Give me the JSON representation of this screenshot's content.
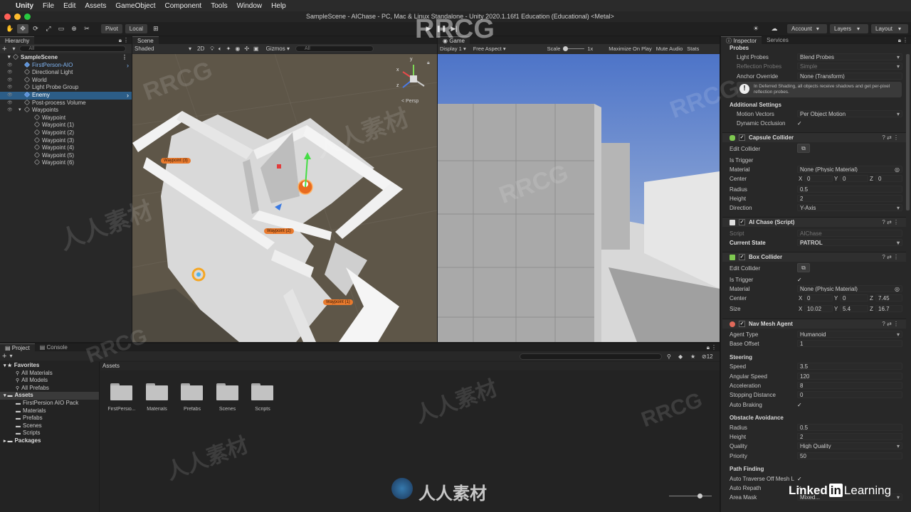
{
  "menubar": {
    "apple": "",
    "app": "Unity",
    "items": [
      "File",
      "Edit",
      "Assets",
      "GameObject",
      "Component",
      "Tools",
      "Window",
      "Help"
    ]
  },
  "window": {
    "title": "SampleScene - AIChase - PC, Mac & Linux Standalone - Unity 2020.1.16f1 Education (Educational) <Metal>"
  },
  "toolbar": {
    "pivot": "Pivot",
    "local": "Local",
    "account": "Account",
    "layers": "Layers",
    "layout": "Layout"
  },
  "hierarchy": {
    "tab": "Hierarchy",
    "search": "All",
    "scene": "SampleScene",
    "items": [
      {
        "label": "FirstPerson-AIO",
        "depth": 1,
        "prefab": true
      },
      {
        "label": "Directional Light",
        "depth": 1
      },
      {
        "label": "World",
        "depth": 1
      },
      {
        "label": "Light Probe Group",
        "depth": 1
      },
      {
        "label": "Enemy",
        "depth": 1,
        "selected": true
      },
      {
        "label": "Post-process Volume",
        "depth": 1
      },
      {
        "label": "Waypoints",
        "depth": 1
      },
      {
        "label": "Waypoint",
        "depth": 2
      },
      {
        "label": "Waypoint (1)",
        "depth": 2
      },
      {
        "label": "Waypoint (2)",
        "depth": 2
      },
      {
        "label": "Waypoint (3)",
        "depth": 2
      },
      {
        "label": "Waypoint (4)",
        "depth": 2
      },
      {
        "label": "Waypoint (5)",
        "depth": 2
      },
      {
        "label": "Waypoint (6)",
        "depth": 2
      }
    ]
  },
  "scene": {
    "tab": "Scene",
    "shading": "Shaded",
    "mode2d": "2D",
    "gizmos": "Gizmos",
    "search": "All",
    "persp": "< Persp",
    "waypoints": [
      "Waypoint (3)",
      "Waypoint (2)",
      "Waypoint (1)"
    ],
    "axis": {
      "y": "y",
      "x": "x",
      "z": "z"
    }
  },
  "game": {
    "tab": "Game",
    "display": "Display 1",
    "aspect": "Free Aspect",
    "scale": "Scale",
    "scale_val": "1x",
    "maximize": "Maximize On Play",
    "mute": "Mute Audio",
    "stats": "Stats"
  },
  "project": {
    "tab_project": "Project",
    "tab_console": "Console",
    "assets_header": "Assets",
    "count": "12",
    "tree": [
      {
        "label": "Favorites",
        "bold": true,
        "depth": 0
      },
      {
        "label": "All Materials",
        "depth": 1
      },
      {
        "label": "All Models",
        "depth": 1
      },
      {
        "label": "All Prefabs",
        "depth": 1
      },
      {
        "label": "Assets",
        "bold": true,
        "depth": 0,
        "selected": true
      },
      {
        "label": "FirstPersion AIO Pack",
        "depth": 1
      },
      {
        "label": "Materials",
        "depth": 1
      },
      {
        "label": "Prefabs",
        "depth": 1
      },
      {
        "label": "Scenes",
        "depth": 1
      },
      {
        "label": "Scripts",
        "depth": 1
      },
      {
        "label": "Packages",
        "bold": true,
        "depth": 0
      }
    ],
    "folders": [
      "FirstPersio...",
      "Materials",
      "Prefabs",
      "Scenes",
      "Scripts"
    ]
  },
  "inspector": {
    "tab_inspector": "Inspector",
    "tab_services": "Services",
    "probes": "Probes",
    "light_probes_lbl": "Light Probes",
    "light_probes_val": "Blend Probes",
    "reflection_lbl": "Reflection Probes",
    "reflection_val": "Simple",
    "anchor_lbl": "Anchor Override",
    "anchor_val": "None (Transform)",
    "info": "In Deferred Shading, all objects receive shadows and get per-pixel reflection probes.",
    "additional": "Additional Settings",
    "motion_lbl": "Motion Vectors",
    "motion_val": "Per Object Motion",
    "dynocc_lbl": "Dynamic Occlusion",
    "capsule": {
      "title": "Capsule Collider",
      "edit": "Edit Collider",
      "trigger": "Is Trigger",
      "material_lbl": "Material",
      "material_val": "None (Physic Material)",
      "center_lbl": "Center",
      "cx": "0",
      "cy": "0",
      "cz": "0",
      "radius_lbl": "Radius",
      "radius_val": "0.5",
      "height_lbl": "Height",
      "height_val": "2",
      "dir_lbl": "Direction",
      "dir_val": "Y-Axis"
    },
    "aichase": {
      "title": "AI Chase (Script)",
      "script_lbl": "Script",
      "script_val": "AIChase",
      "state_lbl": "Current State",
      "state_val": "PATROL"
    },
    "box": {
      "title": "Box Collider",
      "edit": "Edit Collider",
      "trigger": "Is Trigger",
      "material_lbl": "Material",
      "material_val": "None (Physic Material)",
      "center_lbl": "Center",
      "cx": "0",
      "cy": "0",
      "cz": "7.45",
      "size_lbl": "Size",
      "sx": "10.02",
      "sy": "5.4",
      "sz": "16.7"
    },
    "nav": {
      "title": "Nav Mesh Agent",
      "type_lbl": "Agent Type",
      "type_val": "Humanoid",
      "offset_lbl": "Base Offset",
      "offset_val": "1",
      "steering": "Steering",
      "speed_lbl": "Speed",
      "speed_val": "3.5",
      "ang_lbl": "Angular Speed",
      "ang_val": "120",
      "acc_lbl": "Acceleration",
      "acc_val": "8",
      "stop_lbl": "Stopping Distance",
      "stop_val": "0",
      "brake_lbl": "Auto Braking",
      "obstacle": "Obstacle Avoidance",
      "oradius_lbl": "Radius",
      "oradius_val": "0.5",
      "oheight_lbl": "Height",
      "oheight_val": "2",
      "quality_lbl": "Quality",
      "quality_val": "High Quality",
      "priority_lbl": "Priority",
      "priority_val": "50",
      "path": "Path Finding",
      "traverse_lbl": "Auto Traverse Off Mesh L",
      "repath_lbl": "Auto Repath",
      "area_lbl": "Area Mask",
      "area_val": "Mixed..."
    }
  },
  "watermark": {
    "main": "RRCG",
    "cn": "人人素材",
    "bottom": "人人素材",
    "linkedin": "Linked",
    "in": "in",
    "learning": "Learning"
  },
  "symbols": {
    "check": "✓",
    "x": "X",
    "y": "Y",
    "z": "Z",
    "gear": "⚙",
    "dots": "⋮",
    "question": "?"
  }
}
